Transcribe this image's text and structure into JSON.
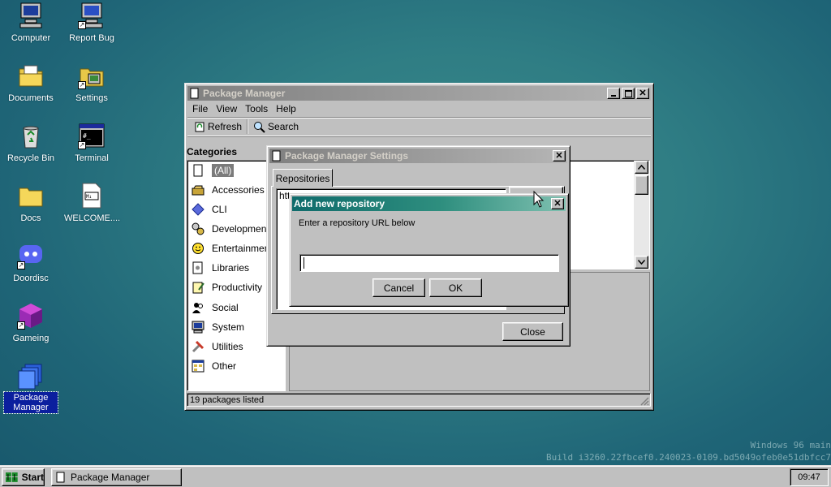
{
  "desktop": {
    "icons": [
      {
        "label": "Computer",
        "icon": "computer-icon"
      },
      {
        "label": "Report Bug",
        "icon": "report-bug-icon"
      },
      {
        "label": "Documents",
        "icon": "documents-folder-icon"
      },
      {
        "label": "Settings",
        "icon": "settings-icon"
      },
      {
        "label": "Recycle Bin",
        "icon": "recycle-bin-icon"
      },
      {
        "label": "Terminal",
        "icon": "terminal-icon"
      },
      {
        "label": "Docs",
        "icon": "folder-icon"
      },
      {
        "label": "WELCOME....",
        "icon": "markdown-file-icon"
      },
      {
        "label": "Doordisc",
        "icon": "doordisc-icon"
      },
      {
        "label": "Gameing",
        "icon": "cube-icon"
      },
      {
        "label": "Package Manager",
        "icon": "package-manager-icon"
      }
    ]
  },
  "package_manager": {
    "title": "Package Manager",
    "menu": [
      "File",
      "View",
      "Tools",
      "Help"
    ],
    "toolbar": {
      "refresh": "Refresh",
      "search": "Search"
    },
    "categories_heading": "Categories",
    "categories": [
      "(All)",
      "Accessories",
      "CLI",
      "Development",
      "Entertainment",
      "Libraries",
      "Productivity",
      "Social",
      "System",
      "Utilities",
      "Other"
    ],
    "status": "19 packages listed"
  },
  "settings_dialog": {
    "title": "Package Manager Settings",
    "tab": "Repositories",
    "repo_url_partial": "htt",
    "close": "Close"
  },
  "add_repo_dialog": {
    "title": "Add new repository",
    "prompt": "Enter a repository URL below",
    "input_value": "",
    "cancel": "Cancel",
    "ok": "OK"
  },
  "watermark": {
    "line1": "Windows 96 main",
    "line2": "Build i3260.22fbcef0.240023-0109.bd5049ofeb0e51dbfcc7"
  },
  "taskbar": {
    "start": "Start",
    "task": "Package Manager",
    "clock": "09:47"
  },
  "colors": {
    "desktop": "#2f7d84",
    "active_title": "#0f6b6b",
    "selection": "#0b1f9e"
  }
}
